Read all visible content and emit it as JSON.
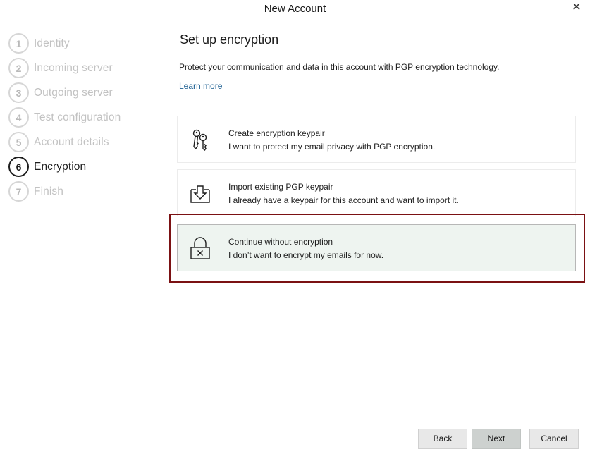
{
  "window": {
    "title": "New Account",
    "close_label": "✕"
  },
  "steps": [
    {
      "num": "1",
      "label": "Identity",
      "active": false
    },
    {
      "num": "2",
      "label": "Incoming server",
      "active": false
    },
    {
      "num": "3",
      "label": "Outgoing server",
      "active": false
    },
    {
      "num": "4",
      "label": "Test configuration",
      "active": false
    },
    {
      "num": "5",
      "label": "Account details",
      "active": false
    },
    {
      "num": "6",
      "label": "Encryption",
      "active": true
    },
    {
      "num": "7",
      "label": "Finish",
      "active": false
    }
  ],
  "main": {
    "heading": "Set up encryption",
    "description": "Protect your communication and data in this account with PGP encryption technology.",
    "learn_more": "Learn more",
    "options": [
      {
        "icon": "keys-icon",
        "title": "Create encryption keypair",
        "desc": "I want to protect my email privacy with PGP encryption.",
        "selected": false
      },
      {
        "icon": "import-icon",
        "title": "Import existing PGP keypair",
        "desc": "I already have a keypair for this account and want to import it.",
        "selected": false
      },
      {
        "icon": "lock-x-icon",
        "title": "Continue without encryption",
        "desc": "I don’t want to encrypt my emails for now.",
        "selected": true
      }
    ]
  },
  "buttons": {
    "back": "Back",
    "next": "Next",
    "cancel": "Cancel"
  },
  "colors": {
    "highlight": "#7b1113",
    "link": "#1b5e91",
    "selected_bg": "#eef4f0"
  }
}
